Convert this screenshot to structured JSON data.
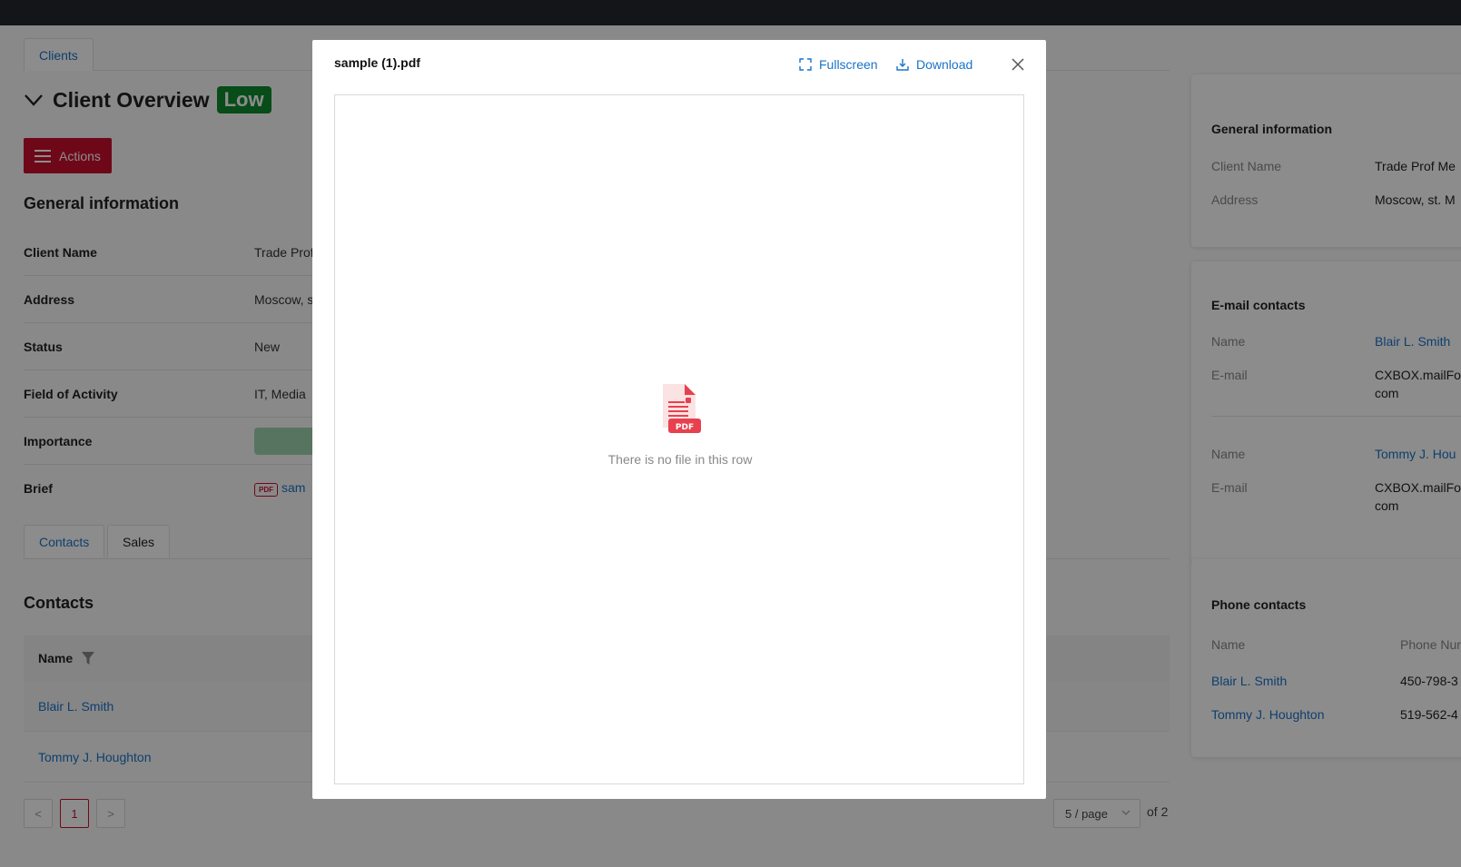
{
  "page": {
    "tabs": [
      "Clients"
    ],
    "title": "Client Overview",
    "importance_badge": "Low",
    "actions_label": "Actions",
    "general_heading": "General information",
    "general": [
      {
        "label": "Client Name",
        "value": "Trade Prof"
      },
      {
        "label": "Address",
        "value": "Moscow, s"
      },
      {
        "label": "Status",
        "value": "New"
      },
      {
        "label": "Field of Activity",
        "value": "IT, Media"
      },
      {
        "label": "Importance",
        "value": ""
      },
      {
        "label": "Brief",
        "value": "sam"
      }
    ],
    "brief_pdf_tag": "PDF",
    "subtabs": [
      "Contacts",
      "Sales"
    ],
    "contacts_heading": "Contacts",
    "contacts_table": {
      "header": "Name",
      "rows": [
        "Blair L. Smith",
        "Tommy J. Houghton"
      ]
    },
    "pagination": {
      "prev": "<",
      "current": "1",
      "next": ">",
      "page_size": "5 / page",
      "total": "of 2"
    }
  },
  "side": {
    "general_card": {
      "heading": "General information",
      "rows": [
        {
          "label": "Client Name",
          "value": "Trade Prof Me"
        },
        {
          "label": "Address",
          "value": "Moscow, st. M"
        }
      ]
    },
    "email_card": {
      "heading": "E-mail contacts",
      "entries": [
        {
          "name_label": "Name",
          "name": "Blair L. Smith",
          "email_label": "E-mail",
          "email_line1": "CXBOX.mailFo",
          "email_line2": "com"
        },
        {
          "name_label": "Name",
          "name": "Tommy J. Hou",
          "email_label": "E-mail",
          "email_line1": "CXBOX.mailFo",
          "email_line2": "com"
        }
      ]
    },
    "phone_card": {
      "heading": "Phone contacts",
      "col_name": "Name",
      "col_phone": "Phone Nur",
      "rows": [
        {
          "name": "Blair L. Smith",
          "phone": "450-798-3"
        },
        {
          "name": "Tommy J. Houghton",
          "phone": "519-562-4"
        }
      ]
    }
  },
  "modal": {
    "title": "sample (1).pdf",
    "fullscreen_label": "Fullscreen",
    "download_label": "Download",
    "pdf_badge": "PDF",
    "empty_text": "There is no file in this row"
  },
  "colors": {
    "accent_red": "#c8102e",
    "link_blue": "#1a73c9",
    "badge_green": "#0e8a2e",
    "topbar": "#25272c"
  }
}
